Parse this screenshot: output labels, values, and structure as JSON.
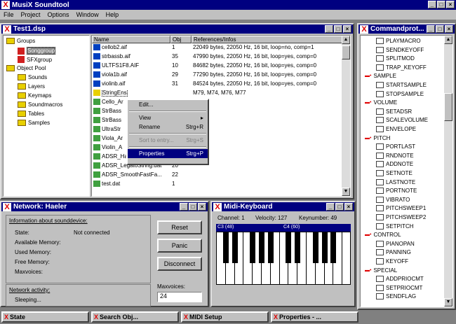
{
  "app": {
    "title": "MusiX Soundtool"
  },
  "menu": [
    "File",
    "Project",
    "Options",
    "Window",
    "Help"
  ],
  "project_window": {
    "title": "Test1.dsp",
    "tree": [
      {
        "label": "Groups",
        "kind": "folder"
      },
      {
        "label": "Songgroup",
        "kind": "item"
      },
      {
        "label": "SFXgroup",
        "kind": "item"
      },
      {
        "label": "Object Pool",
        "kind": "folder"
      },
      {
        "label": "Sounds",
        "kind": "folder"
      },
      {
        "label": "Layers",
        "kind": "folder"
      },
      {
        "label": "Keymaps",
        "kind": "folder"
      },
      {
        "label": "Soundmacros",
        "kind": "folder"
      },
      {
        "label": "Tables",
        "kind": "folder"
      },
      {
        "label": "Samples",
        "kind": "folder"
      }
    ],
    "columns": [
      "Name",
      "Obj",
      "References/Infos"
    ],
    "rows": [
      {
        "name": "cellob2.aif",
        "obj": "1",
        "info": "22049 bytes, 22050 Hz, 16 bit, loop=no, comp=1"
      },
      {
        "name": "strbassb.aif",
        "obj": "35",
        "info": "47990 bytes, 22050 Hz, 16 bit, loop=yes, comp=0"
      },
      {
        "name": "ULTFS1F8.AIF",
        "obj": "10",
        "info": "84682 bytes, 22050 Hz, 16 bit, loop=yes, comp=0"
      },
      {
        "name": "viola1b.aif",
        "obj": "29",
        "info": "77290 bytes, 22050 Hz, 16 bit, loop=yes, comp=0"
      },
      {
        "name": "violinb.aif",
        "obj": "31",
        "info": "84524 bytes, 22050 Hz, 16 bit, loop=yes, comp=0"
      },
      {
        "name": "StringEns",
        "obj": "",
        "info": "M79, M74, M76, M77"
      },
      {
        "name": "Cello_Ar",
        "obj": "",
        "info": ""
      },
      {
        "name": "StrBass",
        "obj": "",
        "info": ""
      },
      {
        "name": "StrBass",
        "obj": "",
        "info": ""
      },
      {
        "name": "UltraStr",
        "obj": "",
        "info": ""
      },
      {
        "name": "Viola_Ar",
        "obj": "",
        "info": ""
      },
      {
        "name": "Violin_A",
        "obj": "",
        "info": ""
      },
      {
        "name": "ADSR_HardString.dat",
        "obj": "260",
        "info": ""
      },
      {
        "name": "ADSR_LegatoString.dat",
        "obj": "20",
        "info": ""
      },
      {
        "name": "ADSR_SmoothFastFa...",
        "obj": "22",
        "info": ""
      },
      {
        "name": "test.dat",
        "obj": "1",
        "info": ""
      }
    ]
  },
  "context_menu": {
    "items": [
      {
        "label": "Edit...",
        "shortcut": "",
        "enabled": true,
        "selected": false
      },
      {
        "label": "",
        "separator": true
      },
      {
        "label": "View",
        "shortcut": "▸",
        "enabled": true,
        "selected": false
      },
      {
        "label": "Rename",
        "shortcut": "Strg+R",
        "enabled": true,
        "selected": false
      },
      {
        "label": "",
        "separator": true
      },
      {
        "label": "Sort to entry...",
        "shortcut": "Strg+S",
        "enabled": false,
        "selected": false
      },
      {
        "label": "",
        "separator": true
      },
      {
        "label": "Properties",
        "shortcut": "Strg+P",
        "enabled": true,
        "selected": true
      }
    ]
  },
  "network": {
    "title": "Network: Haeler",
    "group_label": "Information about sounddevice:",
    "fields": [
      {
        "label": "State:",
        "value": "Not connected"
      },
      {
        "label": "Available Memory:",
        "value": ""
      },
      {
        "label": "Used Memory:",
        "value": ""
      },
      {
        "label": "Free Memory:",
        "value": ""
      },
      {
        "label": "Maxvoices:",
        "value": ""
      }
    ],
    "activity_label": "Network activity:",
    "activity_value": "Sleeping...",
    "buttons": [
      "Reset",
      "Panic",
      "Disconnect"
    ],
    "maxvoices_label": "Maxvoices:",
    "maxvoices_value": "24"
  },
  "midi": {
    "title": "Midi-Keyboard",
    "channel": "Channel: 1",
    "velocity": "Velocity: 127",
    "keynumber": "Keynumber: 49",
    "octaves": [
      "C3 (48)",
      "C4 (60)"
    ]
  },
  "command_window": {
    "title": "Commandprot...",
    "items": [
      {
        "label": "PLAYMACRO",
        "type": "cmd"
      },
      {
        "label": "SENDKEYOFF",
        "type": "cmd"
      },
      {
        "label": "SPLITMOD",
        "type": "cmd"
      },
      {
        "label": "TRAP_KEYOFF",
        "type": "cmd"
      },
      {
        "label": "SAMPLE",
        "type": "group"
      },
      {
        "label": "STARTSAMPLE",
        "type": "cmd"
      },
      {
        "label": "STOPSAMPLE",
        "type": "cmd"
      },
      {
        "label": "VOLUME",
        "type": "group"
      },
      {
        "label": "SETADSR",
        "type": "cmd"
      },
      {
        "label": "SCALEVOLUME",
        "type": "cmd"
      },
      {
        "label": "ENVELOPE",
        "type": "cmd"
      },
      {
        "label": "PITCH",
        "type": "group"
      },
      {
        "label": "PORTLAST",
        "type": "cmd"
      },
      {
        "label": "RNDNOTE",
        "type": "cmd"
      },
      {
        "label": "ADDNOTE",
        "type": "cmd"
      },
      {
        "label": "SETNOTE",
        "type": "cmd"
      },
      {
        "label": "LASTNOTE",
        "type": "cmd"
      },
      {
        "label": "PORTNOTE",
        "type": "cmd"
      },
      {
        "label": "VIBRATO",
        "type": "cmd"
      },
      {
        "label": "PITCHSWEEP1",
        "type": "cmd"
      },
      {
        "label": "PITCHSWEEP2",
        "type": "cmd"
      },
      {
        "label": "SETPITCH",
        "type": "cmd"
      },
      {
        "label": "CONTROL",
        "type": "group"
      },
      {
        "label": "PIANOPAN",
        "type": "cmd"
      },
      {
        "label": "PANNING",
        "type": "cmd"
      },
      {
        "label": "KEYOFF",
        "type": "cmd"
      },
      {
        "label": "SPECIAL",
        "type": "group"
      },
      {
        "label": "ADDPRIOCMT",
        "type": "cmd"
      },
      {
        "label": "SETPRIOCMT",
        "type": "cmd"
      },
      {
        "label": "SENDFLAG",
        "type": "cmd"
      }
    ]
  },
  "taskbar": [
    {
      "label": "State"
    },
    {
      "label": "Search Obj..."
    },
    {
      "label": "MIDI Setup"
    },
    {
      "label": "Properties - ..."
    }
  ],
  "colors": {
    "titlebar": "#000080",
    "face": "#c0c0c0",
    "accent_red": "#e00000",
    "selection": "#000080"
  }
}
